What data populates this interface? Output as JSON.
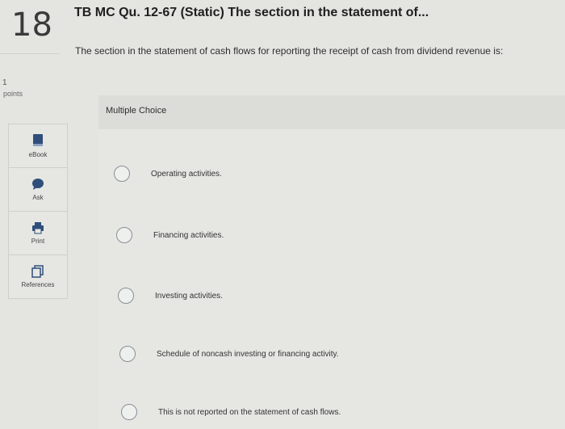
{
  "question_number": "18",
  "points": {
    "value": "1",
    "label": "points"
  },
  "tools": [
    {
      "label": "eBook",
      "icon": "ebook-icon"
    },
    {
      "label": "Ask",
      "icon": "ask-icon"
    },
    {
      "label": "Print",
      "icon": "print-icon"
    },
    {
      "label": "References",
      "icon": "references-icon"
    }
  ],
  "title": "TB MC Qu. 12-67 (Static) The section in the statement of...",
  "prompt": "The section in the statement of cash flows for reporting the receipt of cash from dividend revenue is:",
  "multiple_choice_label": "Multiple Choice",
  "choices": [
    "Operating activities.",
    "Financing activities.",
    "Investing activities.",
    "Schedule of noncash investing or financing activity.",
    "This is not reported on the statement of cash flows."
  ],
  "colors": {
    "icon_blue": "#2f4e7a",
    "background": "#e4e5e1"
  }
}
